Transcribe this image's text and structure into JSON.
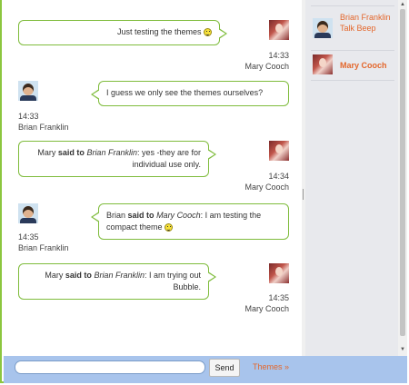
{
  "messages": [
    {
      "sender": "Mary Cooch",
      "side": "right",
      "html_parts": [
        {
          "t": "Just testing the themes "
        }
      ],
      "smiley": true,
      "time": "14:33"
    },
    {
      "sender": "Brian Franklin",
      "side": "left",
      "html_parts": [
        {
          "t": "I guess we only see the themes ourselves?"
        }
      ],
      "smiley": false,
      "time": "14:33"
    },
    {
      "sender": "Mary Cooch",
      "side": "right",
      "time": "14:34",
      "smiley": false,
      "parts": {
        "name": "Mary",
        "said": "said to",
        "target": "Brian Franklin",
        "text": ": yes -they are for individual use only."
      }
    },
    {
      "sender": "Brian Franklin",
      "side": "left",
      "time": "14:35",
      "smiley": true,
      "parts": {
        "name": "Brian",
        "said": "said to",
        "target": "Mary Cooch",
        "text": ": I am testing the compact theme "
      }
    },
    {
      "sender": "Mary Cooch",
      "side": "right",
      "time": "14:35",
      "smiley": false,
      "parts": {
        "name": "Mary",
        "said": "said to",
        "target": "Brian Franklin",
        "text": ": I am trying out Bubble."
      }
    }
  ],
  "users": [
    {
      "name": "Brian Franklin",
      "status": "Talk Beep",
      "label": "Brian Franklin Talk Beep",
      "bold": false
    },
    {
      "name": "Mary Cooch",
      "label": "Mary Cooch",
      "bold": true
    }
  ],
  "input": {
    "value": "",
    "placeholder": ""
  },
  "send_label": "Send",
  "themes_label": "Themes »",
  "colors": {
    "accent": "#e4672c",
    "bubble_border": "#7fbc3c",
    "frame": "#8cc63f",
    "bottombar": "#a8c4ec",
    "sidebar": "#e8e9ed"
  }
}
